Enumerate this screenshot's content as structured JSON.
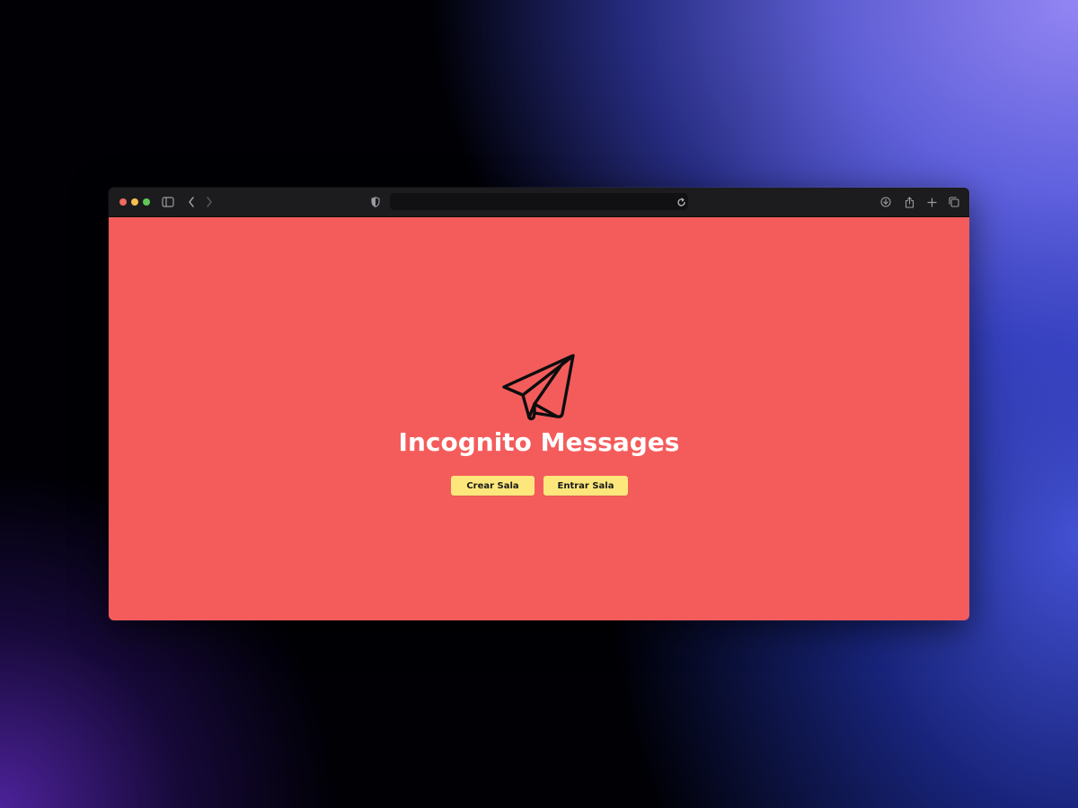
{
  "browser": {
    "address_bar": {
      "url": ""
    },
    "icons": {
      "sidebar": "sidebar-icon",
      "back": "chevron-left-icon",
      "forward": "chevron-right-icon",
      "privacy": "shield-icon",
      "reload": "reload-icon",
      "download": "download-icon",
      "share": "share-icon",
      "new_tab": "plus-icon",
      "tab_overview": "tabs-icon"
    }
  },
  "page": {
    "logo_icon": "paper-plane-icon",
    "title": "Incognito Messages",
    "buttons": {
      "create_label": "Crear Sala",
      "join_label": "Entrar Sala"
    }
  },
  "colors": {
    "page_background": "#f45c5c",
    "button_background": "#fde77c",
    "title_text": "#ffffff"
  }
}
